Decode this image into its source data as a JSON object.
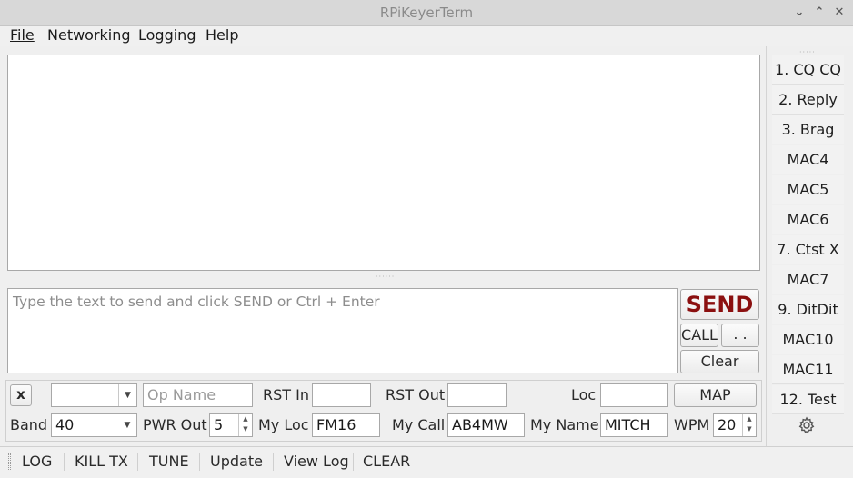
{
  "window": {
    "title": "RPiKeyerTerm",
    "controls": [
      "⌄",
      "⌃",
      "✕"
    ]
  },
  "menu": {
    "file": "File",
    "networking": "Networking",
    "logging": "Logging",
    "help": "Help"
  },
  "input": {
    "placeholder": "Type the text to send and click SEND or Ctrl + Enter"
  },
  "buttons": {
    "send": "SEND",
    "call": "CALL",
    "dots": ". .",
    "clear": "Clear",
    "close_x": "x",
    "map": "MAP"
  },
  "form": {
    "op_name_placeholder": "Op Name",
    "rst_in_label": "RST In",
    "rst_in_value": "",
    "rst_out_label": "RST Out",
    "rst_out_value": "",
    "loc_label": "Loc",
    "loc_value": "",
    "band_label": "Band",
    "band_value": "40",
    "pwr_label": "PWR Out",
    "pwr_value": "5",
    "my_loc_label": "My Loc",
    "my_loc_value": "FM16",
    "my_call_label": "My Call",
    "my_call_value": "AB4MW",
    "my_name_label": "My Name",
    "my_name_value": "MITCH",
    "wpm_label": "WPM",
    "wpm_value": "20",
    "call_combo_value": ""
  },
  "macros": [
    "1. CQ CQ",
    "2. Reply",
    "3. Brag",
    "MAC4",
    "MAC5",
    "MAC6",
    "7. Ctst X",
    "MAC7",
    "9. DitDit",
    "MAC10",
    "MAC11",
    "12. Test"
  ],
  "toolbar": {
    "log": "LOG",
    "kill_tx": "KILL TX",
    "tune": "TUNE",
    "update": "Update",
    "view_log": "View Log",
    "clear": "CLEAR"
  },
  "colors": {
    "send_text": "#8b1010"
  }
}
